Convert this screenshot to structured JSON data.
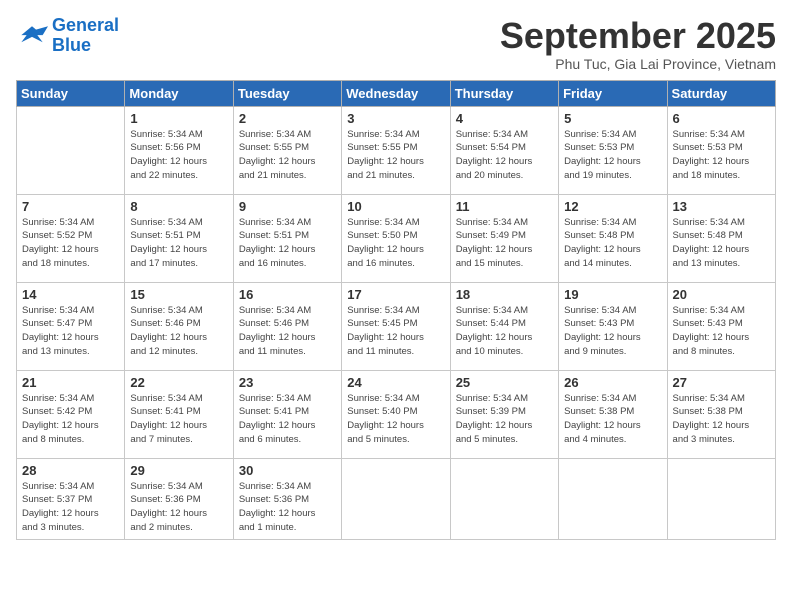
{
  "logo": {
    "line1": "General",
    "line2": "Blue"
  },
  "title": "September 2025",
  "subtitle": "Phu Tuc, Gia Lai Province, Vietnam",
  "days_of_week": [
    "Sunday",
    "Monday",
    "Tuesday",
    "Wednesday",
    "Thursday",
    "Friday",
    "Saturday"
  ],
  "weeks": [
    [
      {
        "day": "",
        "info": ""
      },
      {
        "day": "1",
        "info": "Sunrise: 5:34 AM\nSunset: 5:56 PM\nDaylight: 12 hours\nand 22 minutes."
      },
      {
        "day": "2",
        "info": "Sunrise: 5:34 AM\nSunset: 5:55 PM\nDaylight: 12 hours\nand 21 minutes."
      },
      {
        "day": "3",
        "info": "Sunrise: 5:34 AM\nSunset: 5:55 PM\nDaylight: 12 hours\nand 21 minutes."
      },
      {
        "day": "4",
        "info": "Sunrise: 5:34 AM\nSunset: 5:54 PM\nDaylight: 12 hours\nand 20 minutes."
      },
      {
        "day": "5",
        "info": "Sunrise: 5:34 AM\nSunset: 5:53 PM\nDaylight: 12 hours\nand 19 minutes."
      },
      {
        "day": "6",
        "info": "Sunrise: 5:34 AM\nSunset: 5:53 PM\nDaylight: 12 hours\nand 18 minutes."
      }
    ],
    [
      {
        "day": "7",
        "info": "Sunrise: 5:34 AM\nSunset: 5:52 PM\nDaylight: 12 hours\nand 18 minutes."
      },
      {
        "day": "8",
        "info": "Sunrise: 5:34 AM\nSunset: 5:51 PM\nDaylight: 12 hours\nand 17 minutes."
      },
      {
        "day": "9",
        "info": "Sunrise: 5:34 AM\nSunset: 5:51 PM\nDaylight: 12 hours\nand 16 minutes."
      },
      {
        "day": "10",
        "info": "Sunrise: 5:34 AM\nSunset: 5:50 PM\nDaylight: 12 hours\nand 16 minutes."
      },
      {
        "day": "11",
        "info": "Sunrise: 5:34 AM\nSunset: 5:49 PM\nDaylight: 12 hours\nand 15 minutes."
      },
      {
        "day": "12",
        "info": "Sunrise: 5:34 AM\nSunset: 5:48 PM\nDaylight: 12 hours\nand 14 minutes."
      },
      {
        "day": "13",
        "info": "Sunrise: 5:34 AM\nSunset: 5:48 PM\nDaylight: 12 hours\nand 13 minutes."
      }
    ],
    [
      {
        "day": "14",
        "info": "Sunrise: 5:34 AM\nSunset: 5:47 PM\nDaylight: 12 hours\nand 13 minutes."
      },
      {
        "day": "15",
        "info": "Sunrise: 5:34 AM\nSunset: 5:46 PM\nDaylight: 12 hours\nand 12 minutes."
      },
      {
        "day": "16",
        "info": "Sunrise: 5:34 AM\nSunset: 5:46 PM\nDaylight: 12 hours\nand 11 minutes."
      },
      {
        "day": "17",
        "info": "Sunrise: 5:34 AM\nSunset: 5:45 PM\nDaylight: 12 hours\nand 11 minutes."
      },
      {
        "day": "18",
        "info": "Sunrise: 5:34 AM\nSunset: 5:44 PM\nDaylight: 12 hours\nand 10 minutes."
      },
      {
        "day": "19",
        "info": "Sunrise: 5:34 AM\nSunset: 5:43 PM\nDaylight: 12 hours\nand 9 minutes."
      },
      {
        "day": "20",
        "info": "Sunrise: 5:34 AM\nSunset: 5:43 PM\nDaylight: 12 hours\nand 8 minutes."
      }
    ],
    [
      {
        "day": "21",
        "info": "Sunrise: 5:34 AM\nSunset: 5:42 PM\nDaylight: 12 hours\nand 8 minutes."
      },
      {
        "day": "22",
        "info": "Sunrise: 5:34 AM\nSunset: 5:41 PM\nDaylight: 12 hours\nand 7 minutes."
      },
      {
        "day": "23",
        "info": "Sunrise: 5:34 AM\nSunset: 5:41 PM\nDaylight: 12 hours\nand 6 minutes."
      },
      {
        "day": "24",
        "info": "Sunrise: 5:34 AM\nSunset: 5:40 PM\nDaylight: 12 hours\nand 5 minutes."
      },
      {
        "day": "25",
        "info": "Sunrise: 5:34 AM\nSunset: 5:39 PM\nDaylight: 12 hours\nand 5 minutes."
      },
      {
        "day": "26",
        "info": "Sunrise: 5:34 AM\nSunset: 5:38 PM\nDaylight: 12 hours\nand 4 minutes."
      },
      {
        "day": "27",
        "info": "Sunrise: 5:34 AM\nSunset: 5:38 PM\nDaylight: 12 hours\nand 3 minutes."
      }
    ],
    [
      {
        "day": "28",
        "info": "Sunrise: 5:34 AM\nSunset: 5:37 PM\nDaylight: 12 hours\nand 3 minutes."
      },
      {
        "day": "29",
        "info": "Sunrise: 5:34 AM\nSunset: 5:36 PM\nDaylight: 12 hours\nand 2 minutes."
      },
      {
        "day": "30",
        "info": "Sunrise: 5:34 AM\nSunset: 5:36 PM\nDaylight: 12 hours\nand 1 minute."
      },
      {
        "day": "",
        "info": ""
      },
      {
        "day": "",
        "info": ""
      },
      {
        "day": "",
        "info": ""
      },
      {
        "day": "",
        "info": ""
      }
    ]
  ]
}
